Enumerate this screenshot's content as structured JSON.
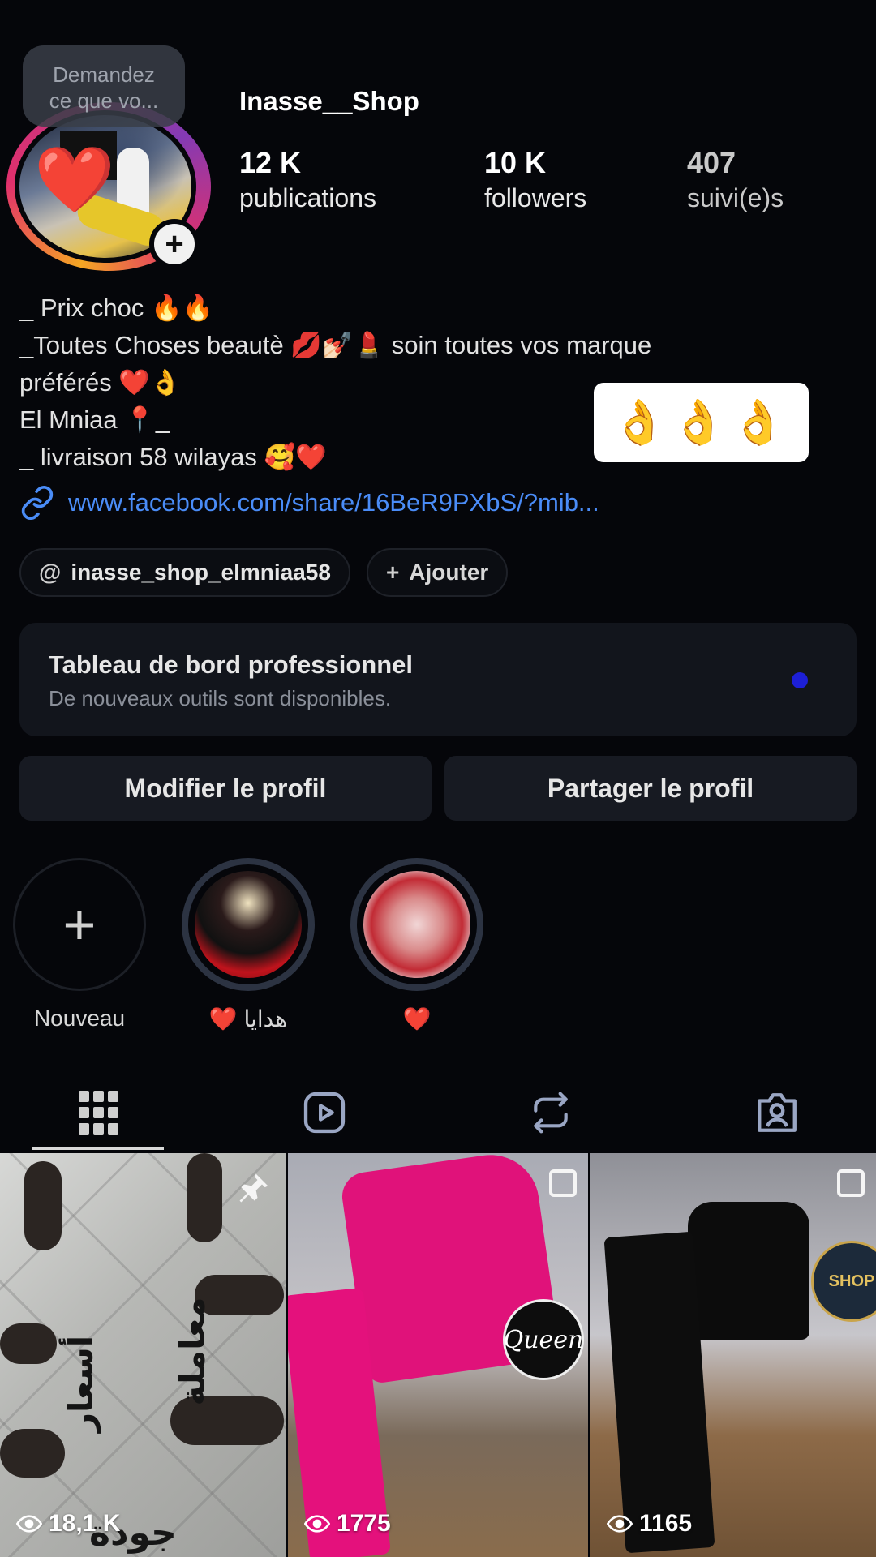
{
  "profile": {
    "ask_tooltip_line1": "Demandez",
    "ask_tooltip_line2": "ce que vo...",
    "username": "Inasse__Shop",
    "stats": {
      "posts_count": "12 K",
      "posts_label": "publications",
      "followers_count": "10 K",
      "followers_label": "followers",
      "following_count": "407",
      "following_label": "suivi(e)s"
    },
    "bio": [
      "_ Prix choc 🔥🔥",
      "_Toutes Choses beautè 💋💅🏻💄 soin toutes vos marque",
      "préférés ❤️👌",
      "El Mniaa 📍_",
      "_ livraison 58 wilayas 🥰❤️"
    ],
    "emoji_sticker": "👌👌👌",
    "link": "www.facebook.com/share/16BeR9PXbS/?mib...",
    "threads_handle": "inasse_shop_elmniaa58",
    "add_label": "Ajouter"
  },
  "dashboard": {
    "title": "Tableau de bord professionnel",
    "subtitle": "De nouveaux outils sont disponibles.",
    "dot_color": "#1d1fd6"
  },
  "buttons": {
    "edit": "Modifier le profil",
    "share": "Partager le profil"
  },
  "highlights": [
    {
      "label": "Nouveau",
      "icon": "plus-icon"
    },
    {
      "label": "❤️ هدايا"
    },
    {
      "label": "❤️"
    }
  ],
  "tabs": [
    {
      "icon": "grid-icon",
      "selected": true
    },
    {
      "icon": "reels-icon",
      "selected": false
    },
    {
      "icon": "reposts-icon",
      "selected": false
    },
    {
      "icon": "tagged-icon",
      "selected": false
    }
  ],
  "posts": [
    {
      "views": "18,1 K",
      "pinned": true,
      "text_vertical_1": "معاملة",
      "text_vertical_2": "أسعار",
      "text_bottom": "جودة"
    },
    {
      "views": "1775",
      "multi": true,
      "badge_text": "Queen"
    },
    {
      "views": "1165",
      "multi": true,
      "badge_text": "SHOP"
    }
  ],
  "colors": {
    "background": "#05060a",
    "link": "#4a8cf7",
    "card": "#12151c",
    "button": "#171a22"
  }
}
